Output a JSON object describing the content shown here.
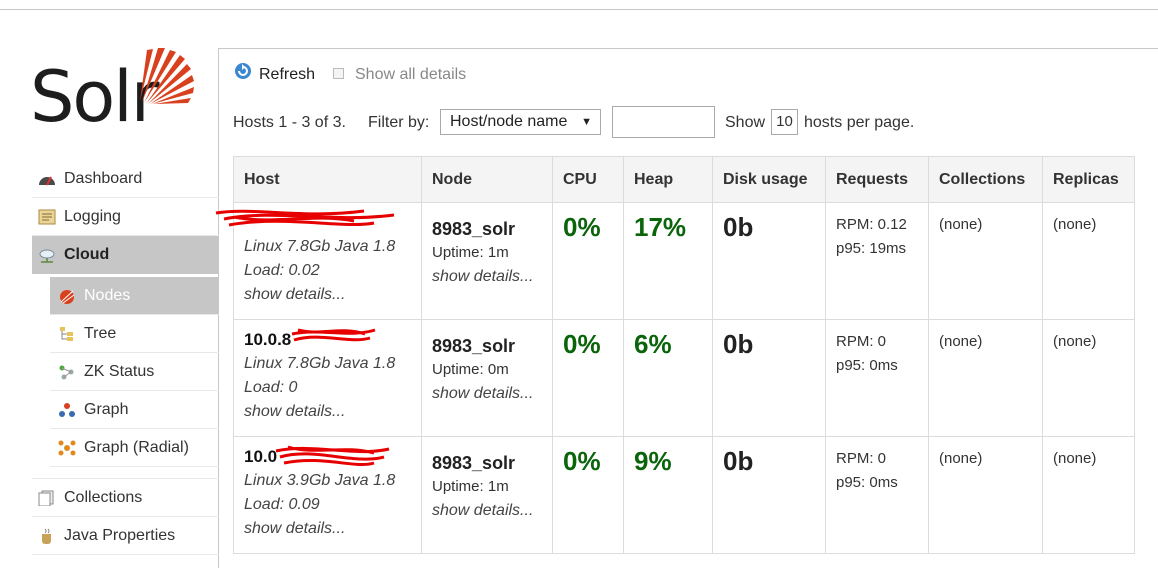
{
  "logo": {
    "text": "Solr"
  },
  "colors": {
    "accent": "#d9411e",
    "good": "#0a640a",
    "active_bg": "#c6c6c6"
  },
  "sidebar": {
    "items": [
      {
        "label": "Dashboard",
        "icon": "dashboard-icon"
      },
      {
        "label": "Logging",
        "icon": "logging-icon"
      },
      {
        "label": "Cloud",
        "icon": "cloud-icon"
      },
      {
        "label": "Nodes",
        "icon": "solr-sun-icon"
      },
      {
        "label": "Tree",
        "icon": "tree-icon"
      },
      {
        "label": "ZK Status",
        "icon": "zk-status-icon"
      },
      {
        "label": "Graph",
        "icon": "graph-icon"
      },
      {
        "label": "Graph (Radial)",
        "icon": "graph-radial-icon"
      },
      {
        "label": "Collections",
        "icon": "collections-icon"
      },
      {
        "label": "Java Properties",
        "icon": "java-icon"
      }
    ]
  },
  "toolbar": {
    "refresh_label": "Refresh",
    "show_all_label": "Show all details"
  },
  "filter": {
    "hosts_text": "Hosts 1 - 3 of 3.",
    "filter_by": "Filter by:",
    "select_value": "Host/node name",
    "show_label": "Show",
    "per_page": "10",
    "per_page_suffix": "hosts per page."
  },
  "table": {
    "headers": [
      "Host",
      "Node",
      "CPU",
      "Heap",
      "Disk usage",
      "Requests",
      "Collections",
      "Replicas"
    ],
    "rows": [
      {
        "host": "",
        "os": "Linux 7.8Gb Java 1.8",
        "load": "Load: 0.02",
        "host_details": "show details...",
        "node": "8983_solr",
        "uptime": "Uptime: 1m",
        "node_details": "show details...",
        "cpu": "0%",
        "heap": "17%",
        "disk": "0b",
        "rpm": "RPM: 0.12",
        "p95": "p95: 19ms",
        "collections": "(none)",
        "replicas": "(none)"
      },
      {
        "host": "10.0.8",
        "os": "Linux 7.8Gb Java 1.8",
        "load": "Load: 0",
        "host_details": "show details...",
        "node": "8983_solr",
        "uptime": "Uptime: 0m",
        "node_details": "show details...",
        "cpu": "0%",
        "heap": "6%",
        "disk": "0b",
        "rpm": "RPM: 0",
        "p95": "p95: 0ms",
        "collections": "(none)",
        "replicas": "(none)"
      },
      {
        "host": "10.0",
        "os": "Linux 3.9Gb Java 1.8",
        "load": "Load: 0.09",
        "host_details": "show details...",
        "node": "8983_solr",
        "uptime": "Uptime: 1m",
        "node_details": "show details...",
        "cpu": "0%",
        "heap": "9%",
        "disk": "0b",
        "rpm": "RPM: 0",
        "p95": "p95: 0ms",
        "collections": "(none)",
        "replicas": "(none)"
      }
    ]
  }
}
